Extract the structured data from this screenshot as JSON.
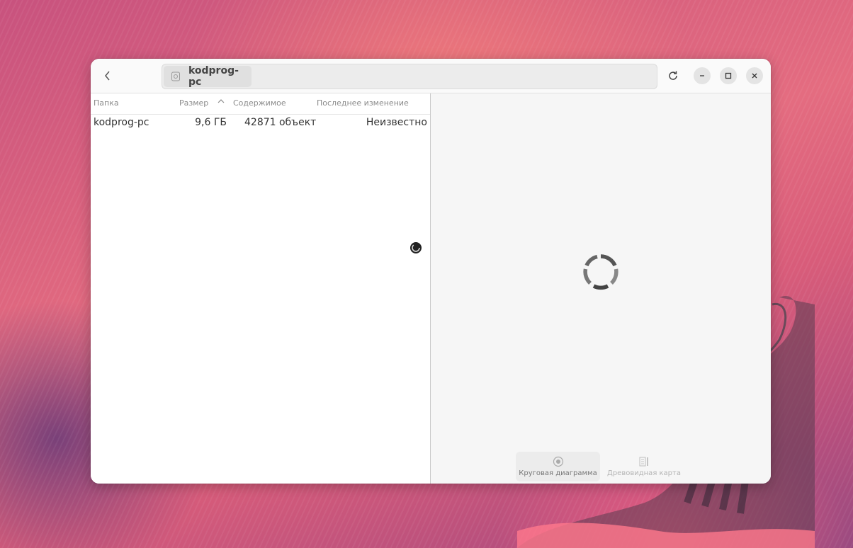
{
  "window": {
    "location": "kodprog-pc"
  },
  "table": {
    "headers": {
      "folder": "Папка",
      "size": "Размер",
      "content": "Содержимое",
      "modified": "Последнее изменение"
    },
    "rows": [
      {
        "name": "kodprog-pc",
        "size": "9,6 ГБ",
        "content": "42871 объект",
        "modified": "Неизвестно"
      }
    ]
  },
  "view_switcher": {
    "pie_label": "Круговая диаграмма",
    "tree_label": "Древовидная карта"
  },
  "icons": {
    "back": "go-back-icon",
    "drive": "drive-icon",
    "reload": "reload-icon",
    "minimize": "minimize-icon",
    "maximize": "maximize-icon",
    "close": "close-icon",
    "sort": "sort-ascending-icon",
    "pie": "pie-chart-icon",
    "treemap": "treemap-icon",
    "spinner": "loading-spinner-icon"
  }
}
